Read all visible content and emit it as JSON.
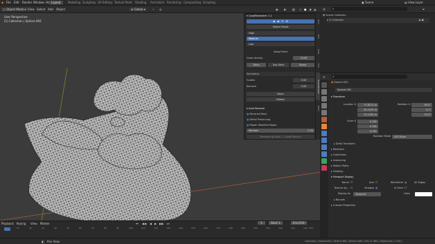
{
  "topbar": {
    "menus": [
      "File",
      "Edit",
      "Render",
      "Window",
      "Help"
    ],
    "tabs": [
      "Layout",
      "Modeling",
      "Sculpting",
      "UV Editing",
      "Texture Paint",
      "Shading",
      "Animation",
      "Rendering",
      "Compositing",
      "Scripting"
    ],
    "active_tab": "Layout",
    "scene_label": "Scene",
    "view_layer_label": "View Layer"
  },
  "viewport_header": {
    "mode": "Object Mode",
    "menus": [
      "View",
      "Select",
      "Add",
      "Object"
    ],
    "orientation": "Global"
  },
  "viewport": {
    "view_name": "User Perspective",
    "collection_path": "(1) Collection | Sphere.002"
  },
  "npanel": {
    "title": "QuadRemesher 1.1",
    "select_preset_label": "Select Preset",
    "presets": [
      "High",
      "Medium",
      "Low"
    ],
    "selected_preset": "Medium",
    "adapt_title": "Adapt Point",
    "quad_density_label": "Quad density",
    "quad_density_value": "10.00",
    "mode_value": "Dens",
    "use_dens_label": "Use Dens",
    "sharp_label": "Sharp",
    "sharp_value": "0.0",
    "symmetry_label": "Symmetry",
    "guides_label": "Guides",
    "guides_value": "0.00",
    "remesh_label": "Remesh",
    "remesh_value": "0.00",
    "basic_label": "Basic",
    "detect_label": "Detect",
    "auto_remesh_title": "Auto Remesh",
    "mirror_label": "Mirrored Mesh",
    "smooth_label": "Detail Preserving",
    "repair_label": "Repair Manifold Edges",
    "remesh_button": "Remesh",
    "remesh_button_value": "0.00",
    "footer_label": "Remeshing Done — Quad Density"
  },
  "vtabs": [
    "Item",
    "Tool",
    "View",
    "Edit",
    "Quad Remesh",
    "Mesh"
  ],
  "timeline": {
    "menus": [
      "Playback",
      "Keying",
      "View",
      "Marker"
    ],
    "current_frame": "1",
    "start_label": "Start",
    "start_value": "1",
    "end_label": "End",
    "end_value": "250",
    "ticks": [
      "0",
      "10",
      "20",
      "30",
      "40",
      "50",
      "60",
      "70",
      "80",
      "90",
      "100",
      "110",
      "120",
      "130",
      "140",
      "150",
      "160",
      "170",
      "180",
      "190",
      "200",
      "210",
      "220",
      "230",
      "240",
      "250"
    ]
  },
  "statusbar": {
    "left_label": "Pan View",
    "right_info": "Collection | Sphere.002 | Verts:5,984 | Faces:5,982 | Tris:11,964 | Objects:0/1 | 2.90.1"
  },
  "outliner": {
    "header_label": "",
    "scene_collection": "Scene Collection",
    "collection": "Collection"
  },
  "properties": {
    "object_name": "Sphere.002",
    "object_field": "Sphere.002",
    "transform_title": "Transform",
    "location_label": "Location X",
    "location": [
      "77.6213 m",
      "34.1193 m",
      "75.1339 m"
    ],
    "rotation_label": "Rotation X",
    "rotation": [
      "90.0°",
      "0.1°",
      "-70.4°"
    ],
    "scale_label": "Scale X",
    "scale": [
      "0.181",
      "0.181",
      "0.181"
    ],
    "rotation_mode_label": "Rotation Mode",
    "rotation_mode": "XYZ Euler",
    "sections": [
      "Delta Transform",
      "Relations",
      "Collections",
      "Instancing",
      "Motion Paths",
      "Visibility",
      "Viewport Display"
    ],
    "display": {
      "name_label": "Name",
      "axis_label": "Axis",
      "wireframe_label": "Wireframe",
      "all_edges_label": "All Edges",
      "texture_space_label": "Texture Sp...",
      "shadow_label": "Shadow",
      "in_front_label": "In Front",
      "display_as_label": "Display As",
      "display_as_value": "Textured",
      "color_label": "Color",
      "bounds_label": "Bounds"
    },
    "custom_properties": "Custom Properties"
  },
  "colors": {
    "accent": "#4772b3",
    "orange_axis": "#b1593a",
    "red_axis": "#c5395c"
  }
}
